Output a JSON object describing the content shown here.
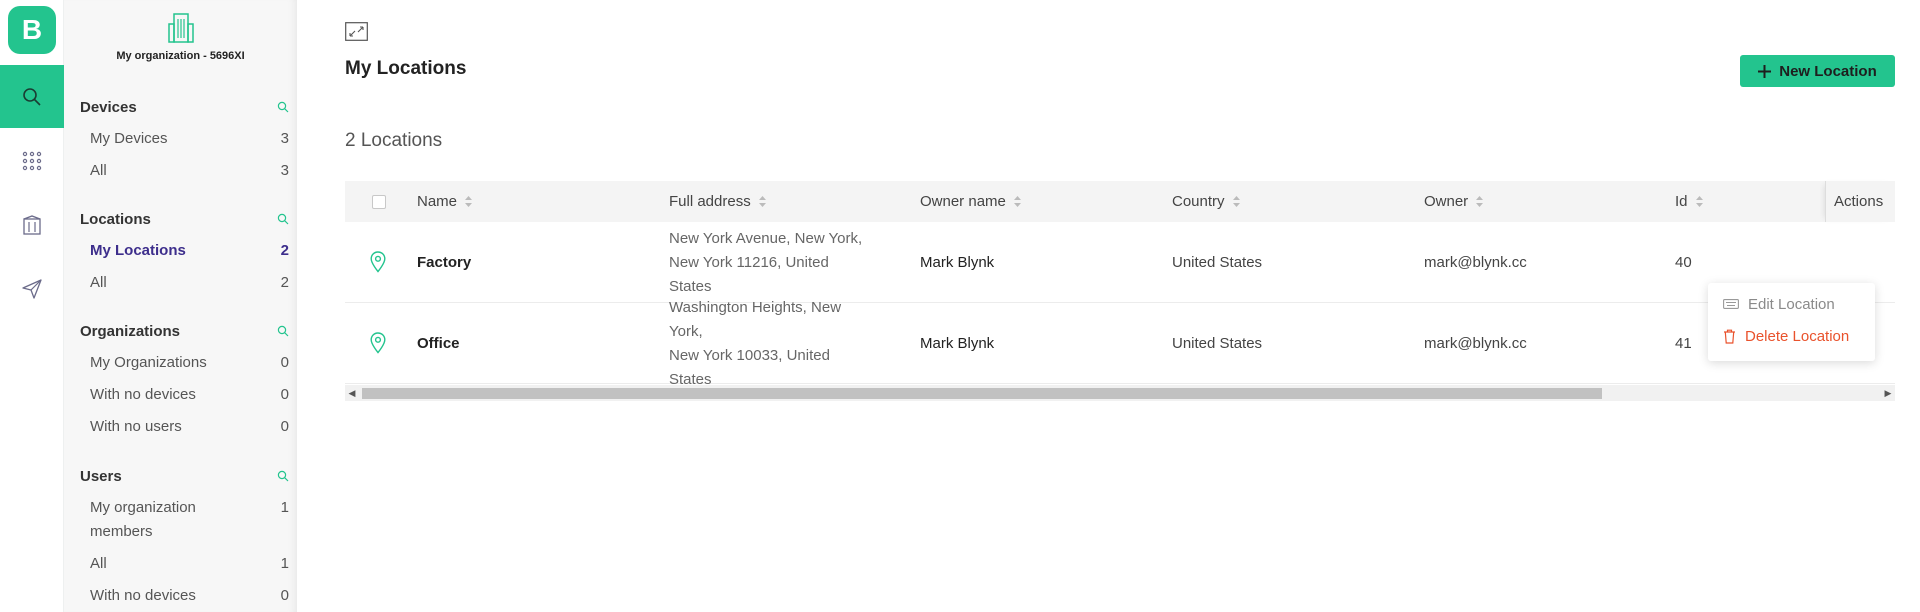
{
  "app": {
    "logo_letter": "B",
    "brand_color": "#23c48e"
  },
  "rail": [
    {
      "icon": "search-icon",
      "active": true
    },
    {
      "icon": "apps-grid-icon",
      "active": false
    },
    {
      "icon": "building-icon",
      "active": false
    },
    {
      "icon": "send-icon",
      "active": false
    }
  ],
  "sidebar": {
    "org_name": "My organization - 5696XI",
    "sections": [
      {
        "title": "Devices",
        "items": [
          {
            "label": "My Devices",
            "count": "3"
          },
          {
            "label": "All",
            "count": "3"
          }
        ]
      },
      {
        "title": "Locations",
        "items": [
          {
            "label": "My Locations",
            "count": "2",
            "active": true
          },
          {
            "label": "All",
            "count": "2"
          }
        ]
      },
      {
        "title": "Organizations",
        "items": [
          {
            "label": "My Organizations",
            "count": "0"
          },
          {
            "label": "With no devices",
            "count": "0"
          },
          {
            "label": "With no users",
            "count": "0"
          }
        ]
      },
      {
        "title": "Users",
        "items": [
          {
            "label": "My organization members",
            "count": "1"
          },
          {
            "label": "All",
            "count": "1"
          },
          {
            "label": "With no devices",
            "count": "0"
          }
        ]
      }
    ]
  },
  "main": {
    "title": "My Locations",
    "new_button": "New Location",
    "count_label": "2 Locations"
  },
  "table": {
    "columns": [
      "Name",
      "Full address",
      "Owner name",
      "Country",
      "Owner",
      "Id"
    ],
    "actions_label": "Actions",
    "rows": [
      {
        "name": "Factory",
        "address_line1": "New York Avenue, New York,",
        "address_line2": "New York 11216, United States",
        "owner_name": "Mark Blynk",
        "country": "United States",
        "owner": "mark@blynk.cc",
        "id": "40"
      },
      {
        "name": "Office",
        "address_line1": "Washington Heights, New York,",
        "address_line2": "New York 10033, United States",
        "owner_name": "Mark Blynk",
        "country": "United States",
        "owner": "mark@blynk.cc",
        "id": "41"
      }
    ]
  },
  "context_menu": {
    "edit": "Edit Location",
    "delete": "Delete Location",
    "delete_color": "#e9522c"
  }
}
